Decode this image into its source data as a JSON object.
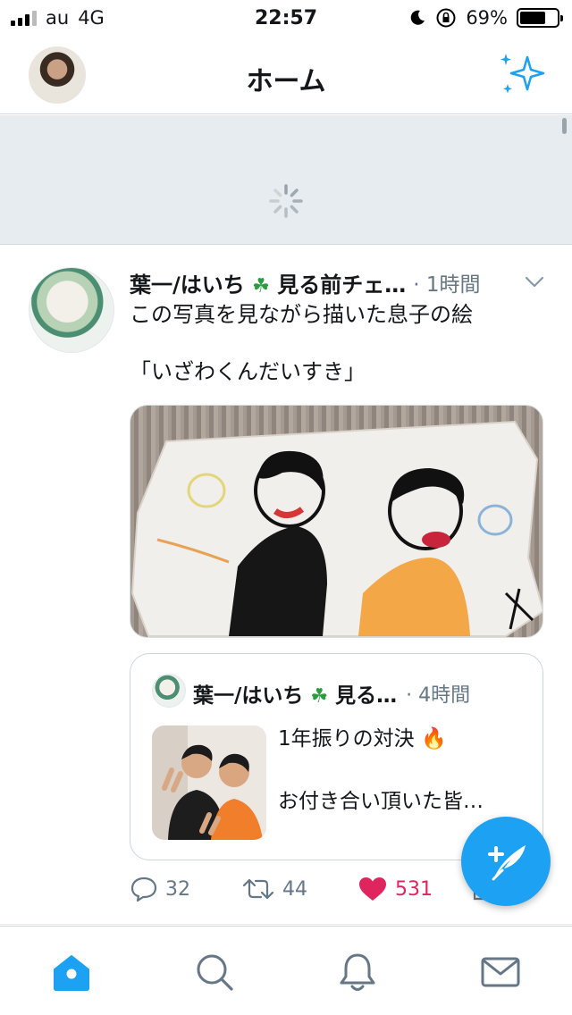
{
  "status_bar": {
    "carrier": "au",
    "network": "4G",
    "time": "22:57",
    "battery": "69%",
    "battery_level": 0.69
  },
  "header": {
    "title": "ホーム",
    "avatar_icon": "profile-avatar",
    "action_icon": "sparkle-icon"
  },
  "colors": {
    "accent": "#1da1f2",
    "like": "#e0245e",
    "muted": "#657786",
    "refresh_bg": "#e6ecf0"
  },
  "tweet": {
    "author": "葉一/はいち",
    "author_suffix": "見る前チェ…",
    "meta": "· 1時間",
    "text_line1": "この写真を見ながら描いた息子の絵",
    "text_line2": "「いざわくんだいすき」",
    "quote": {
      "author": "葉一/はいち",
      "author_suffix": "見る…",
      "meta": "· 4時間",
      "text_line1": "1年振りの対決",
      "text_line2": "お付き合い頂いた皆…"
    },
    "actions": {
      "replies": "32",
      "retweets": "44",
      "likes": "531"
    }
  },
  "tabbar": {
    "items": [
      "home-icon",
      "search-icon",
      "notifications-icon",
      "messages-icon"
    ]
  }
}
